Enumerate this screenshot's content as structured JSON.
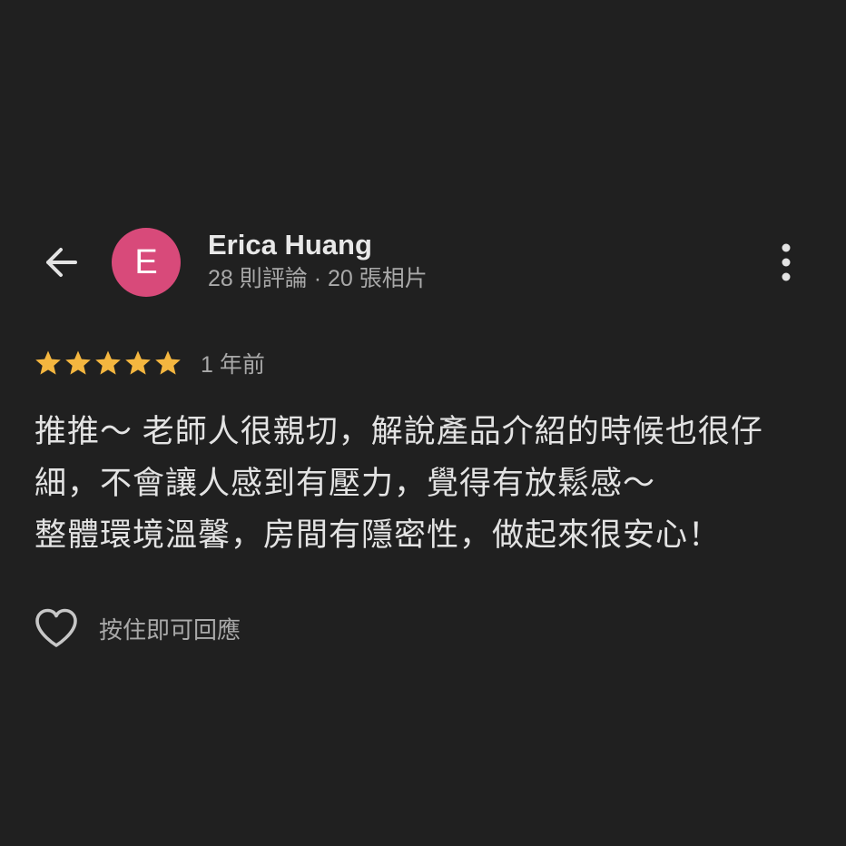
{
  "header": {
    "back_icon": "arrow-back-icon",
    "more_icon": "more-vert-icon"
  },
  "reviewer": {
    "avatar_letter": "E",
    "avatar_color": "#d84a7a",
    "name": "Erica Huang",
    "meta": "28 則評論 · 20 張相片"
  },
  "review": {
    "rating": 5,
    "rating_max": 5,
    "star_color": "#f4b63f",
    "date": "1 年前",
    "lines": [
      "推推～ 老師人很親切，解說產品介紹的時候也很仔",
      "細，不會讓人感到有壓力，覺得有放鬆感～",
      "整體環境溫馨，房間有隱密性，做起來很安心！"
    ]
  },
  "reply": {
    "heart_icon": "heart-outline-icon",
    "hint": "按住即可回應"
  }
}
